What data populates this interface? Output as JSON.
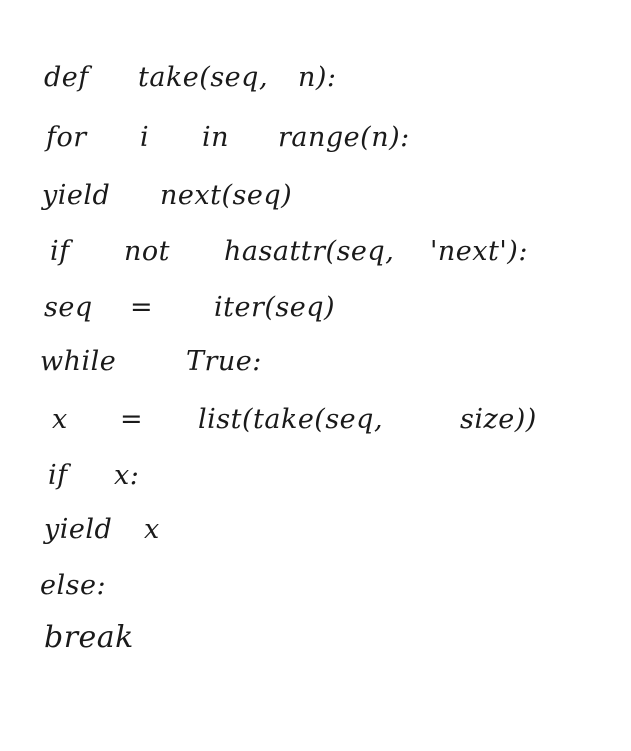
{
  "handwritten_code": {
    "lines": [
      {
        "tokens": [
          "def",
          "take(seq,",
          "n):"
        ]
      },
      {
        "tokens": [
          "for",
          "i",
          "in",
          "range(n):"
        ]
      },
      {
        "tokens": [
          "yield",
          "next(seq)"
        ]
      },
      {
        "tokens": [
          "if",
          "not",
          "hasattr(seq,",
          "'next'):"
        ]
      },
      {
        "tokens": [
          "seq",
          "=",
          "iter(seq)"
        ]
      },
      {
        "tokens": [
          "while",
          "True:"
        ]
      },
      {
        "tokens": [
          "x",
          "=",
          "list(take(seq,",
          "size))"
        ]
      },
      {
        "tokens": [
          "if",
          "x:"
        ]
      },
      {
        "tokens": [
          "yield",
          "x"
        ]
      },
      {
        "tokens": [
          "else:"
        ]
      },
      {
        "tokens": [
          "break"
        ]
      }
    ]
  }
}
